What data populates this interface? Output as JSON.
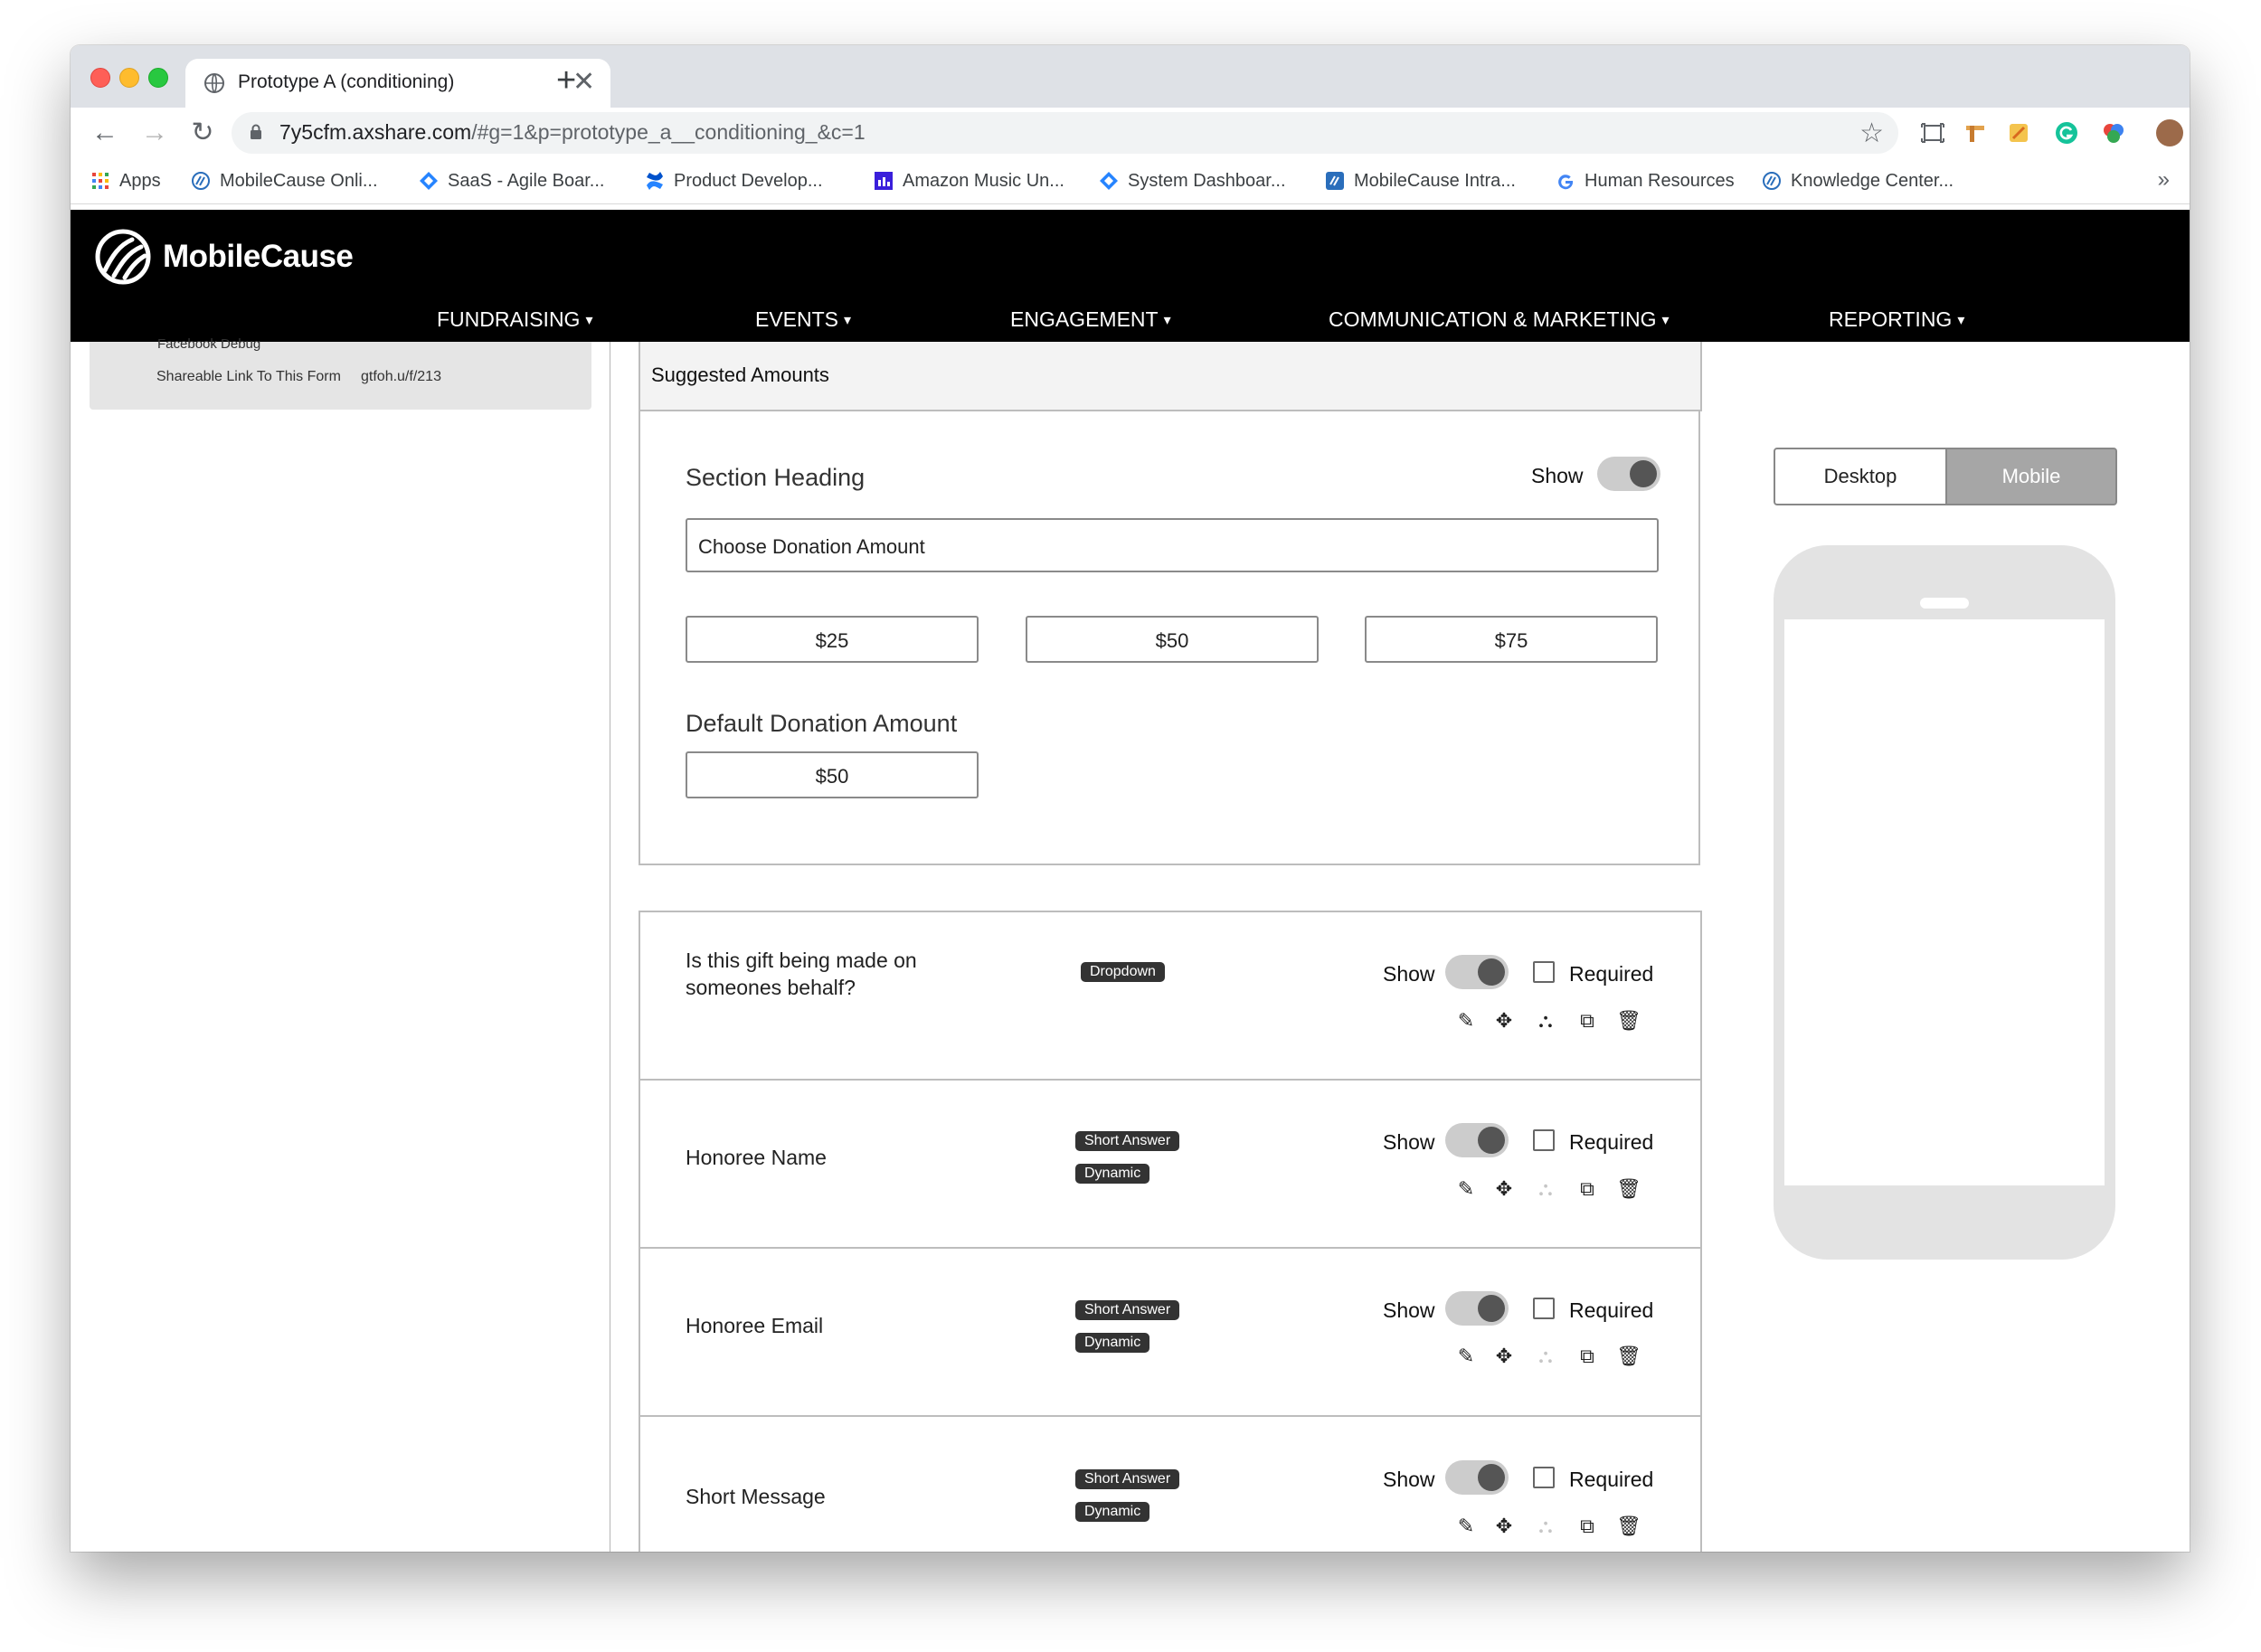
{
  "browser": {
    "tab_title": "Prototype A (conditioning)",
    "tab_close": "✕",
    "new_tab": "+",
    "url_host": "7y5cfm.axshare.com",
    "url_path": "/#g=1&p=prototype_a__conditioning_&c=1",
    "bookmarks": [
      {
        "label": "Apps"
      },
      {
        "label": "MobileCause Onli..."
      },
      {
        "label": "SaaS - Agile Boar..."
      },
      {
        "label": "Product Develop..."
      },
      {
        "label": "Amazon Music Un..."
      },
      {
        "label": "System Dashboar..."
      },
      {
        "label": "MobileCause Intra..."
      },
      {
        "label": "Human Resources"
      },
      {
        "label": "Knowledge Center..."
      }
    ],
    "bookmarks_more": "»"
  },
  "app": {
    "logo_text": "MobileCause",
    "nav": [
      {
        "label": "FUNDRAISING"
      },
      {
        "label": "EVENTS"
      },
      {
        "label": "ENGAGEMENT"
      },
      {
        "label": "COMMUNICATION & MARKETING"
      },
      {
        "label": "REPORTING"
      }
    ],
    "nav_chevron": "⌄"
  },
  "left_panel": {
    "clipped_label": "Facebook Debug",
    "share_label": "Shareable Link To This Form",
    "share_value": "gtfoh.u/f/213"
  },
  "editor": {
    "section_title": "Suggested Amounts",
    "section_heading_label": "Section Heading",
    "show_label": "Show",
    "heading_value": "Choose Donation Amount",
    "amounts": [
      "$25",
      "$50",
      "$75"
    ],
    "default_label": "Default Donation Amount",
    "default_value": "$50",
    "required_label": "Required",
    "fields": [
      {
        "title": "Is this gift being made on someones behalf?",
        "chips": [
          "Dropdown"
        ],
        "show_on": true,
        "required": false
      },
      {
        "title": "Honoree Name",
        "chips": [
          "Short Answer",
          "Dynamic"
        ],
        "show_on": true,
        "required": false
      },
      {
        "title": "Honoree Email",
        "chips": [
          "Short Answer",
          "Dynamic"
        ],
        "show_on": true,
        "required": false
      },
      {
        "title": "Short Message",
        "chips": [
          "Short Answer",
          "Dynamic"
        ],
        "show_on": true,
        "required": false
      }
    ],
    "action_icons": [
      "edit-icon",
      "move-icon",
      "hierarchy-icon",
      "copy-icon",
      "trash-icon"
    ]
  },
  "preview": {
    "desktop_label": "Desktop",
    "mobile_label": "Mobile",
    "selected": "Mobile"
  },
  "colors": {
    "header_bg": "#000000",
    "chip_bg": "#333333",
    "toggle_track": "#cccccc",
    "toggle_knob": "#555555",
    "seg_selected": "#a6a6a6"
  }
}
